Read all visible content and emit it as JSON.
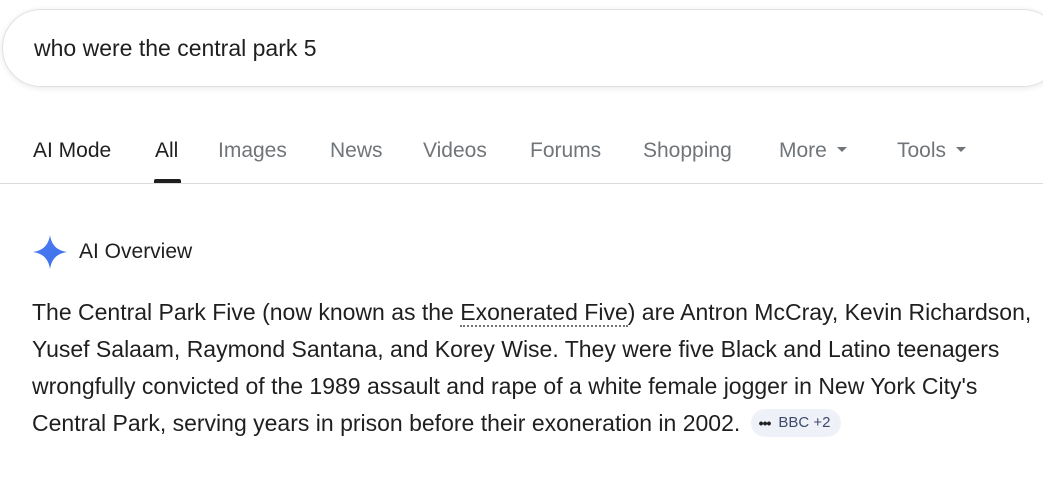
{
  "search": {
    "query": "who were the central park 5"
  },
  "tabs": [
    {
      "label": "AI Mode"
    },
    {
      "label": "All"
    },
    {
      "label": "Images"
    },
    {
      "label": "News"
    },
    {
      "label": "Videos"
    },
    {
      "label": "Forums"
    },
    {
      "label": "Shopping"
    },
    {
      "label": "More"
    },
    {
      "label": "Tools"
    }
  ],
  "active_tab": "All",
  "ai_overview": {
    "title": "AI Overview",
    "text_before_link": "The Central Park Five (now known as the ",
    "link_text": "Exonerated Five",
    "text_after_link": ") are Antron McCray, Kevin Richardson, Yusef Salaam, Raymond Santana, and Korey Wise. They were five Black and Latino teenagers wrongfully convicted of the 1989 assault and rape of a white female jogger in New York City's Central Park, serving years in prison before their exoneration in 2002.",
    "source_chip": {
      "icon": "more-dots-icon",
      "label": "BBC +2"
    }
  },
  "colors": {
    "accent_star": "#4285f4",
    "text": "#1f1f1f",
    "muted": "#70757a",
    "chip_bg": "#eef1f8"
  }
}
